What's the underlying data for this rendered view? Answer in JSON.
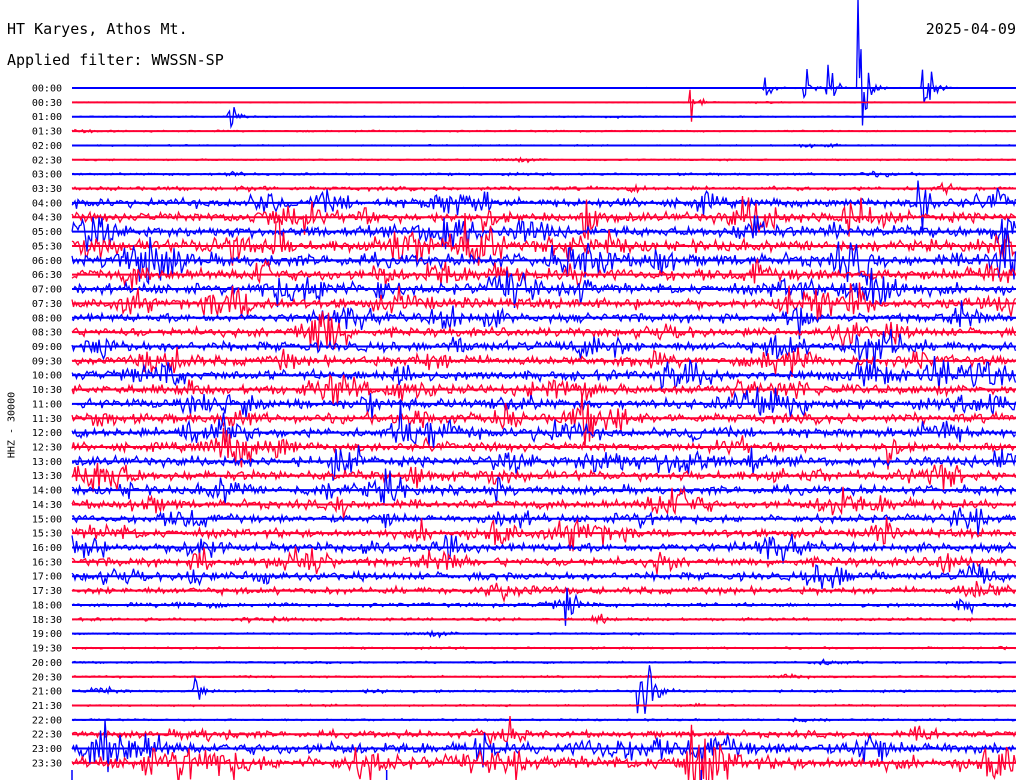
{
  "header": {
    "station": "HT Karyes, Athos Mt.",
    "filter": "Applied filter: WWSSN-SP",
    "date": "2025-04-09"
  },
  "chart_data": {
    "type": "line",
    "title": "HT Karyes, Athos Mt.",
    "subtitle": "Applied filter: WWSSN-SP",
    "ylabel": "HHZ - 30000",
    "xlabel": "",
    "row_interval_minutes": 30,
    "row_labels": [
      "00:00",
      "00:30",
      "01:00",
      "01:30",
      "02:00",
      "02:30",
      "03:00",
      "03:30",
      "04:00",
      "04:30",
      "05:00",
      "05:30",
      "06:00",
      "06:30",
      "07:00",
      "07:30",
      "08:00",
      "08:30",
      "09:00",
      "09:30",
      "10:00",
      "10:30",
      "11:00",
      "11:30",
      "12:00",
      "12:30",
      "13:00",
      "13:30",
      "14:00",
      "14:30",
      "15:00",
      "15:30",
      "16:00",
      "16:30",
      "17:00",
      "17:30",
      "18:00",
      "18:30",
      "19:00",
      "19:30",
      "20:00",
      "20:30",
      "21:00",
      "21:30",
      "22:00",
      "22:30",
      "23:00",
      "23:30"
    ],
    "series_colors": [
      "#0000ff",
      "#ff0033"
    ],
    "noise_level": [
      0.03,
      0.04,
      0.06,
      0.08,
      0.07,
      0.08,
      0.12,
      0.2,
      0.45,
      0.5,
      0.55,
      0.6,
      0.65,
      0.6,
      0.55,
      0.55,
      0.45,
      0.45,
      0.5,
      0.5,
      0.5,
      0.5,
      0.5,
      0.5,
      0.5,
      0.45,
      0.5,
      0.5,
      0.45,
      0.45,
      0.4,
      0.45,
      0.45,
      0.45,
      0.4,
      0.35,
      0.2,
      0.15,
      0.1,
      0.1,
      0.1,
      0.1,
      0.12,
      0.1,
      0.1,
      0.35,
      0.6,
      0.65
    ],
    "events": [
      {
        "row": 0,
        "minute": 24.0,
        "amplitude": 2.2
      },
      {
        "row": 0,
        "minute": 22.0,
        "amplitude": 1.2
      },
      {
        "row": 0,
        "minute": 23.3,
        "amplitude": 1.3
      },
      {
        "row": 0,
        "minute": 25.0,
        "amplitude": 6.5
      },
      {
        "row": 0,
        "minute": 27.0,
        "amplitude": 6.0
      },
      {
        "row": 1,
        "minute": 19.7,
        "amplitude": 1.5
      },
      {
        "row": 2,
        "minute": 5.0,
        "amplitude": 1.2
      },
      {
        "row": 8,
        "minute": 26.9,
        "amplitude": 3.5
      },
      {
        "row": 9,
        "minute": 16.3,
        "amplitude": 2.5
      },
      {
        "row": 11,
        "minute": 6.5,
        "amplitude": 2.5
      },
      {
        "row": 11,
        "minute": 12.5,
        "amplitude": 2.0
      },
      {
        "row": 24,
        "minute": 10.5,
        "amplitude": 2.0
      },
      {
        "row": 36,
        "minute": 15.7,
        "amplitude": 1.5
      },
      {
        "row": 42,
        "minute": 3.9,
        "amplitude": 1.5
      },
      {
        "row": 42,
        "minute": 18.0,
        "amplitude": 3.5
      },
      {
        "row": 42,
        "minute": 18.3,
        "amplitude": 2.5
      }
    ]
  }
}
